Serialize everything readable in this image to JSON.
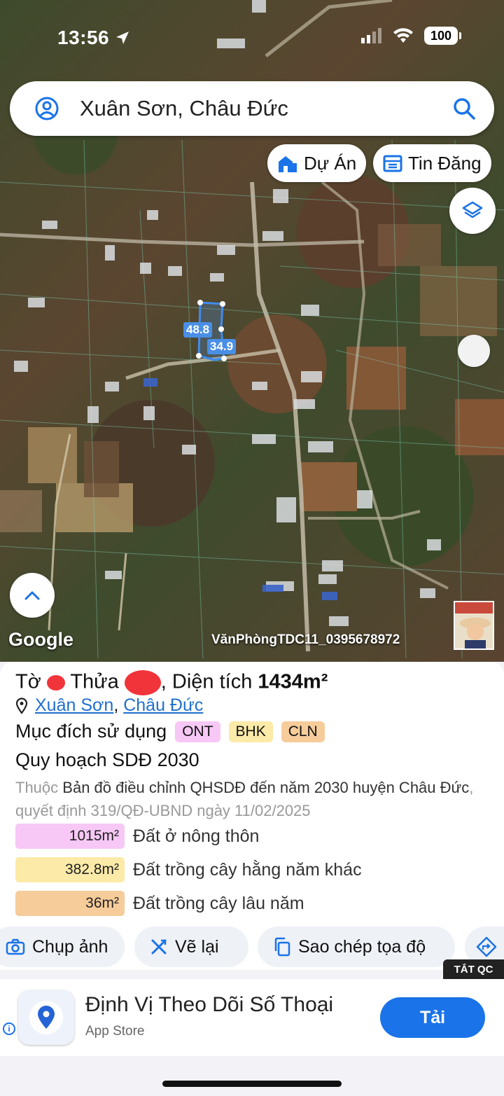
{
  "status_bar": {
    "time": "13:56",
    "battery": "100"
  },
  "search": {
    "value": "Xuân Sơn, Châu Đức"
  },
  "map_buttons": {
    "projects": "Dự Án",
    "listings": "Tin Đăng"
  },
  "plot": {
    "side_a": "48.8",
    "side_b": "34.9"
  },
  "map_footer": {
    "google": "Google",
    "office": "VănPhòngTDC11_0395678972"
  },
  "parcel": {
    "sheet_label": "Tờ",
    "plot_label": "Thửa",
    "area_label": ", Diện tích",
    "area_value": "1434m²",
    "location": {
      "commune": "Xuân Sơn",
      "separator": ",",
      "district": "Châu Đức"
    },
    "purpose_label": "Mục đích sử dụng",
    "purpose_tags": [
      {
        "code": "ONT",
        "color": "#f7c8f5"
      },
      {
        "code": "BHK",
        "color": "#fbeaa8"
      },
      {
        "code": "CLN",
        "color": "#f6cc9a"
      }
    ]
  },
  "plan": {
    "title": "Quy hoạch SDĐ 2030",
    "desc_prefix": "Thuộc",
    "desc_main": "Bản đồ điều chỉnh QHSDĐ đến năm 2030 huyện Châu Đức",
    "desc_suffix": ", quyết định 319/QĐ-UBND ngày 11/02/2025",
    "rows": [
      {
        "value": "1015m²",
        "label": "Đất ở nông thôn",
        "color": "#f7c8f5"
      },
      {
        "value": "382.8m²",
        "label": "Đất trồng cây hằng năm khác",
        "color": "#fbeaa8"
      },
      {
        "value": "36m²",
        "label": "Đất trồng cây lâu năm",
        "color": "#f6cc9a"
      }
    ]
  },
  "actions": {
    "photo": "Chụp ảnh",
    "redraw": "Vẽ lại",
    "copy_coords": "Sao chép tọa độ"
  },
  "ad": {
    "close": "TẮT QC",
    "title": "Định Vị Theo Dõi Số Thoại",
    "source": "App Store",
    "cta": "Tải",
    "info": "i"
  }
}
